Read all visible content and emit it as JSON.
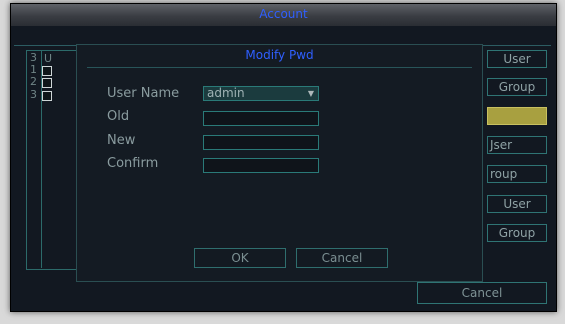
{
  "window": {
    "title": "Account"
  },
  "table": {
    "header_count": "3",
    "header_label": "U",
    "rows": [
      {
        "num": "1"
      },
      {
        "num": "2"
      },
      {
        "num": "3"
      }
    ]
  },
  "side_buttons": [
    {
      "label": "User"
    },
    {
      "label": "Group"
    },
    {
      "label": ""
    },
    {
      "label": "Jser"
    },
    {
      "label": "roup"
    },
    {
      "label": "User"
    },
    {
      "label": "Group"
    }
  ],
  "cancel_main": "Cancel",
  "modal": {
    "title": "Modify Pwd",
    "user_name_label": "User Name",
    "user_name_value": "admin",
    "old_label": "Old",
    "new_label": "New",
    "confirm_label": "Confirm",
    "ok_label": "OK",
    "cancel_label": "Cancel"
  },
  "colors": {
    "title": "#2f5fff",
    "accent": "#a8a040",
    "border": "#2a7a78"
  }
}
